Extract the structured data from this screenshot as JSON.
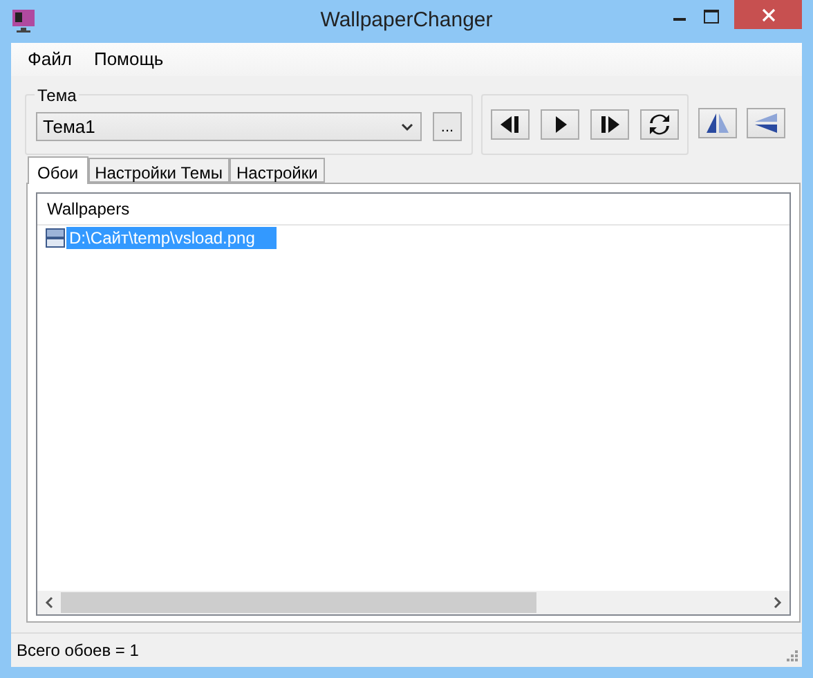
{
  "window": {
    "title": "WallpaperChanger"
  },
  "menu": [
    "Файл",
    "Помощь"
  ],
  "theme_group": {
    "label": "Тема",
    "value": "Тема1",
    "browse_button": "..."
  },
  "tabs": [
    {
      "label": "Обои",
      "selected": true
    },
    {
      "label": "Настройки Темы",
      "selected": false
    },
    {
      "label": "Настройки",
      "selected": false
    }
  ],
  "list": {
    "columns": [
      "Wallpapers"
    ],
    "items": [
      {
        "path": "D:\\Сайт\\temp\\vsload.png",
        "selected": true
      }
    ]
  },
  "status_bar": "Всего обоев = 1"
}
